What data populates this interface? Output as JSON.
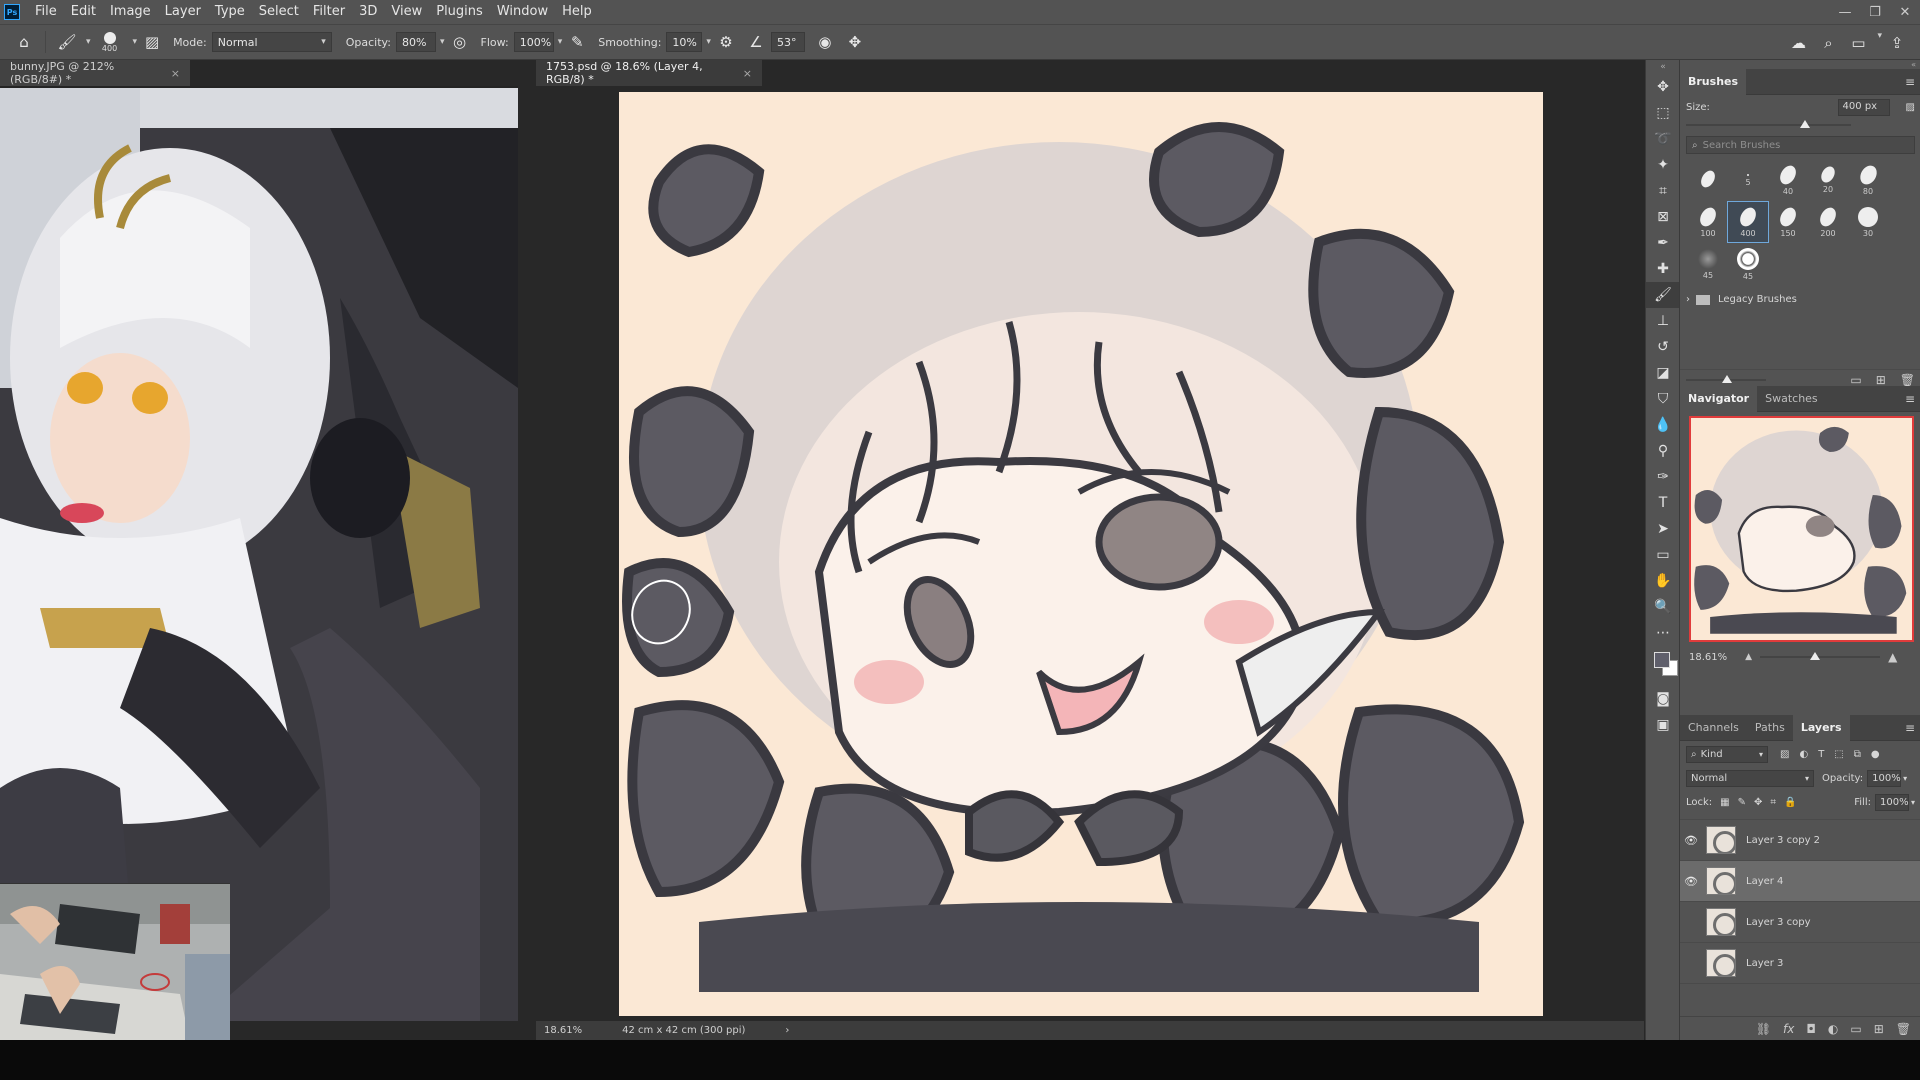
{
  "app": {
    "logo": "Ps"
  },
  "menu": [
    "File",
    "Edit",
    "Image",
    "Layer",
    "Type",
    "Select",
    "Filter",
    "3D",
    "View",
    "Plugins",
    "Window",
    "Help"
  ],
  "window_controls": [
    "minimize-icon",
    "restore-icon",
    "close-icon"
  ],
  "options": {
    "brush_size": "400",
    "mode_label": "Mode:",
    "mode_value": "Normal",
    "opacity_label": "Opacity:",
    "opacity_value": "80%",
    "flow_label": "Flow:",
    "flow_value": "100%",
    "smoothing_label": "Smoothing:",
    "smoothing_value": "10%",
    "angle_value": "53°"
  },
  "tabs": {
    "ref": {
      "label": "bunny.JPG @ 212% (RGB/8#) *",
      "close": "×"
    },
    "main": {
      "label": "1753.psd @ 18.6% (Layer 4, RGB/8) *",
      "close": "×"
    }
  },
  "status": {
    "zoom": "18.61%",
    "doc_size": "42 cm x 42 cm (300 ppi)",
    "arrow": "›"
  },
  "colors": {
    "foreground": "#5f5f6b",
    "background": "#ffffff",
    "canvas": "#fbe8d5",
    "selection_outline": "#e03b3b"
  },
  "brushes_panel": {
    "title": "Brushes",
    "size_label": "Size:",
    "size_value": "400 px",
    "size_fraction": 0.72,
    "search_placeholder": "Search Brushes",
    "presets": [
      {
        "num": ""
      },
      {
        "num": "5"
      },
      {
        "num": "40"
      },
      {
        "num": "20"
      },
      {
        "num": "80"
      },
      {
        "num": "100"
      },
      {
        "num": "400"
      },
      {
        "num": "150"
      },
      {
        "num": "200"
      },
      {
        "num": "30"
      },
      {
        "num": "45"
      },
      {
        "num": "45"
      }
    ],
    "legacy_folder": "Legacy Brushes"
  },
  "navigator": {
    "tabs": [
      "Navigator",
      "Swatches"
    ],
    "zoom": "18.61%"
  },
  "layers_panel": {
    "tabs": [
      "Channels",
      "Paths",
      "Layers"
    ],
    "kind": "Kind",
    "blend_mode": "Normal",
    "opacity_label": "Opacity:",
    "opacity_value": "100%",
    "lock_label": "Lock:",
    "fill_label": "Fill:",
    "fill_value": "100%",
    "layers": [
      {
        "name": "Layer 3 copy 2",
        "visible": true
      },
      {
        "name": "Layer 4",
        "visible": true
      },
      {
        "name": "Layer 3 copy",
        "visible": false
      },
      {
        "name": "Layer 3",
        "visible": false
      }
    ]
  }
}
